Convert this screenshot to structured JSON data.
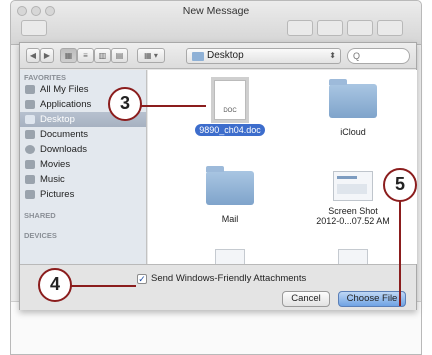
{
  "window": {
    "title": "New Message"
  },
  "toolbar": {
    "back_glyph": "◀",
    "forward_glyph": "▶",
    "view_glyphs": [
      "▦",
      "≡",
      "▥",
      "▤"
    ],
    "arrange_glyph": "▦ ▾",
    "location": "Desktop",
    "search_placeholder": "Q"
  },
  "sidebar": {
    "favorites_header": "FAVORITES",
    "items": [
      {
        "label": "All My Files",
        "icon": "all-files-icon"
      },
      {
        "label": "Applications",
        "icon": "applications-icon"
      },
      {
        "label": "Desktop",
        "icon": "desktop-icon",
        "selected": true
      },
      {
        "label": "Documents",
        "icon": "documents-icon"
      },
      {
        "label": "Downloads",
        "icon": "downloads-icon"
      },
      {
        "label": "Movies",
        "icon": "movies-icon"
      },
      {
        "label": "Music",
        "icon": "music-icon"
      },
      {
        "label": "Pictures",
        "icon": "pictures-icon"
      }
    ],
    "shared_header": "SHARED",
    "devices_header": "DEVICES"
  },
  "files": [
    {
      "name": "9890_ch04.doc",
      "kind": "doc",
      "doc_label": "DOC",
      "selected": true
    },
    {
      "name": "iCloud",
      "kind": "folder"
    },
    {
      "name": "Mail",
      "kind": "folder"
    },
    {
      "name_line1": "Screen Shot",
      "name_line2": "2012-0...07.52 AM",
      "kind": "screenshot"
    }
  ],
  "options": {
    "checkbox_label": "Send Windows-Friendly Attachments",
    "checkbox_checked": true,
    "checkmark": "✓"
  },
  "buttons": {
    "cancel": "Cancel",
    "choose_file": "Choose File"
  },
  "callouts": {
    "three": "3",
    "four": "4",
    "five": "5"
  },
  "colors": {
    "callout": "#8b1d1d",
    "selection": "#3d6dcc",
    "primary_button": "#6fa3e4"
  }
}
